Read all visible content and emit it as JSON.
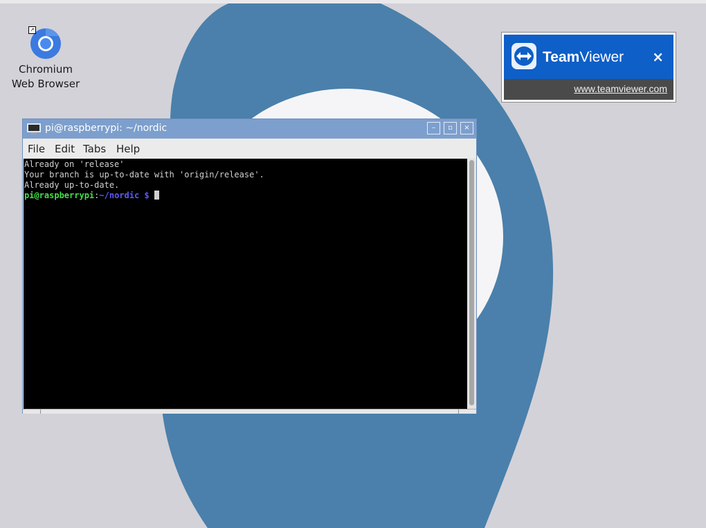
{
  "desktop": {
    "icons": [
      {
        "label_line1": "Chromium",
        "label_line2": "Web Browser",
        "icon": "chromium-icon"
      }
    ],
    "wallpaper": {
      "outer_color": "#4a80ab",
      "inner_color": "#f5f5f7",
      "background": "#d3d2d8"
    }
  },
  "teamviewer": {
    "brand_bold": "Team",
    "brand_rest": "Viewer",
    "close_label": "×",
    "link": "www.teamviewer.com",
    "accent": "#0e5fc8"
  },
  "terminal": {
    "title": "pi@raspberrypi: ~/nordic",
    "window_buttons": {
      "minimize": "–",
      "maximize": "▫",
      "close": "×"
    },
    "menu": [
      "File",
      "Edit",
      "Tabs",
      "Help"
    ],
    "output": [
      "Already on 'release'",
      "Your branch is up-to-date with 'origin/release'.",
      "Already up-to-date."
    ],
    "prompt": {
      "user_host": "pi@raspberrypi",
      "separator": ":",
      "path": "~/nordic",
      "symbol": " $"
    },
    "colors": {
      "user": "#44e04a",
      "path": "#5a5aff",
      "text": "#cfcfcf"
    }
  }
}
